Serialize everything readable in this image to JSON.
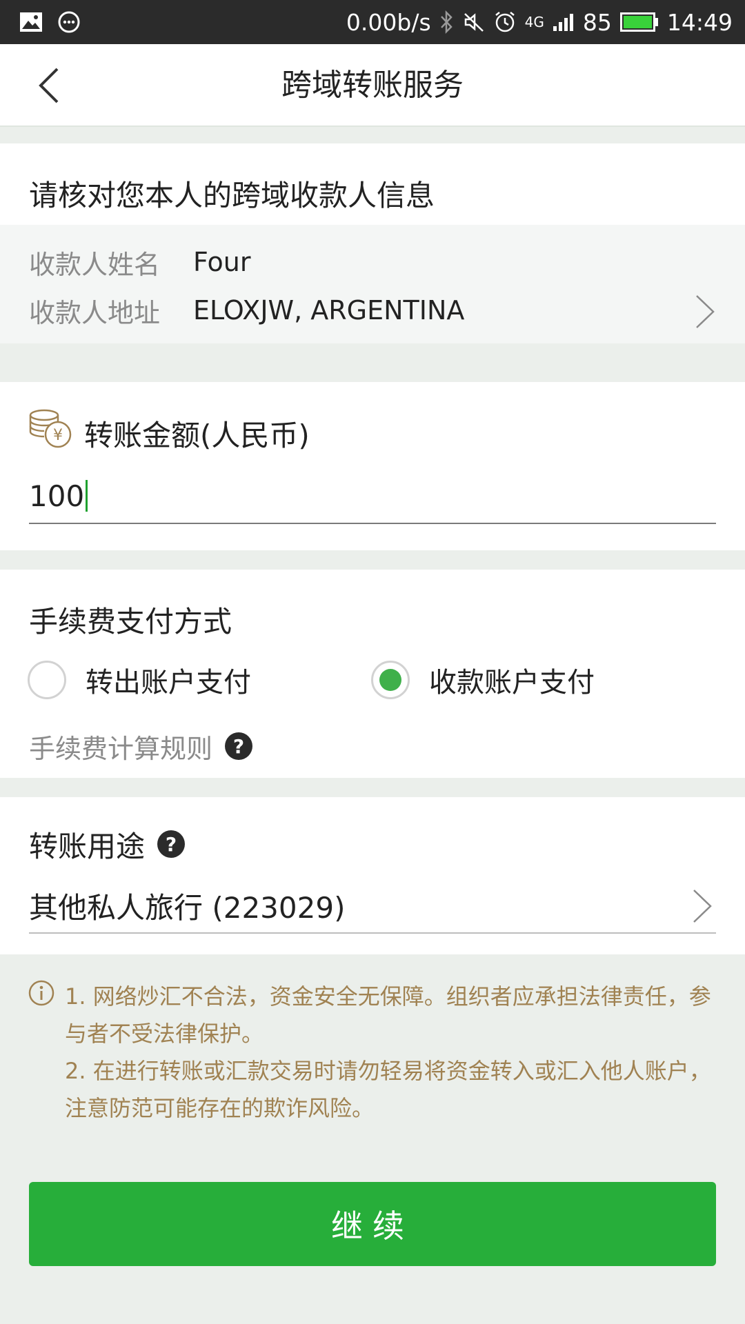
{
  "status_bar": {
    "net_speed": "0.00b/s",
    "network": "4G",
    "battery": "85",
    "time": "14:49"
  },
  "header": {
    "title": "跨域转账服务"
  },
  "payee": {
    "section_title": "请核对您本人的跨域收款人信息",
    "name_label": "收款人姓名",
    "name_value": "Four",
    "address_label": "收款人地址",
    "address_value": "ELOXJW, ARGENTINA"
  },
  "amount": {
    "label": "转账金额(人民币)",
    "value": "100"
  },
  "fee": {
    "section_title": "手续费支付方式",
    "options": [
      {
        "label": "转出账户支付",
        "selected": false
      },
      {
        "label": "收款账户支付",
        "selected": true
      }
    ],
    "rule_label": "手续费计算规则"
  },
  "purpose": {
    "label": "转账用途",
    "value": "其他私人旅行 (223029)"
  },
  "notice": {
    "line1": "1. 网络炒汇不合法，资金安全无保障。组织者应承担法律责任，参与者不受法律保护。",
    "line2": "2. 在进行转账或汇款交易时请勿轻易将资金转入或汇入他人账户，注意防范可能存在的欺诈风险。"
  },
  "actions": {
    "continue_label": "继续"
  },
  "colors": {
    "accent_green": "#27ae3a",
    "radio_green": "#3fb04a",
    "notice_text": "#a08252"
  }
}
